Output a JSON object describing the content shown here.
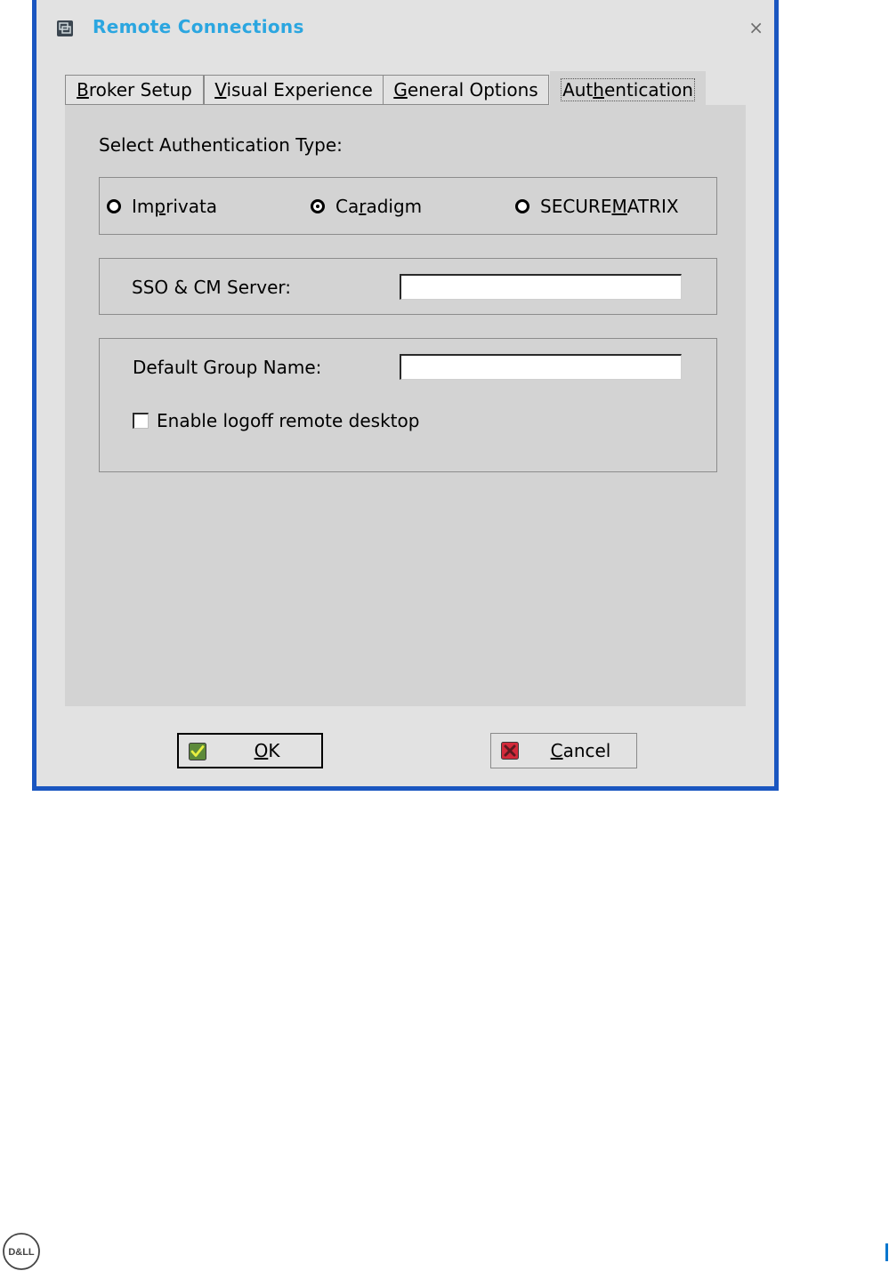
{
  "window": {
    "title": "Remote Connections",
    "close_glyph": "×",
    "icon": "remote-connections-icon",
    "border_color": "#1a56c0",
    "title_color": "#2ba6e0"
  },
  "tabs": [
    {
      "pre": "",
      "u": "B",
      "post": "roker Setup"
    },
    {
      "pre": "",
      "u": "V",
      "post": "isual Experience"
    },
    {
      "pre": "",
      "u": "G",
      "post": "eneral Options"
    },
    {
      "pre": "Aut",
      "u": "h",
      "post": "entication",
      "active": true
    }
  ],
  "auth": {
    "section_label": "Select Authentication Type:",
    "options": [
      {
        "pre": "Im",
        "u": "p",
        "post": "rivata",
        "checked": false
      },
      {
        "pre": "Ca",
        "u": "r",
        "post": "adigm",
        "checked": true
      },
      {
        "pre": "SECURE",
        "u": "M",
        "post": "ATRIX",
        "checked": false
      }
    ],
    "sso_label": "SSO & CM Server:",
    "sso_value": "",
    "group_label": "Default Group Name:",
    "group_value": "",
    "logoff_label": "Enable logoff remote desktop",
    "logoff_checked": false
  },
  "buttons": {
    "ok": {
      "pre": "",
      "u": "O",
      "post": "K"
    },
    "cancel": {
      "pre": "",
      "u": "C",
      "post": "ancel"
    }
  },
  "footer": {
    "logo": "D&LL",
    "accent": "#0076ce"
  }
}
